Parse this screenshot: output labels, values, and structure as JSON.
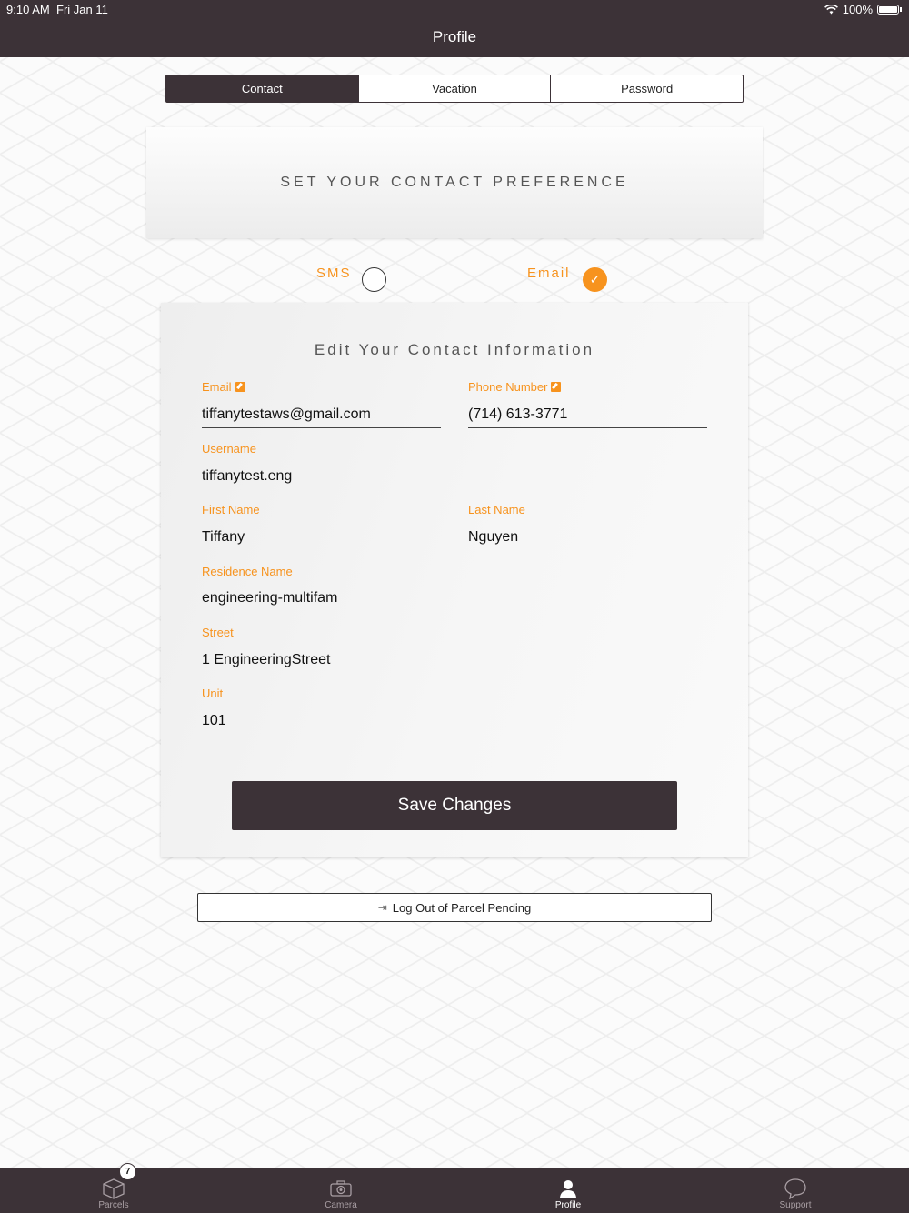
{
  "status_bar": {
    "time": "9:10 AM",
    "date": "Fri Jan 11",
    "battery": "100%"
  },
  "header": {
    "title": "Profile"
  },
  "tabs": [
    {
      "label": "Contact",
      "active": true
    },
    {
      "label": "Vacation",
      "active": false
    },
    {
      "label": "Password",
      "active": false
    }
  ],
  "preference": {
    "title": "SET YOUR CONTACT PREFERENCE",
    "sms_label": "SMS",
    "sms_selected": false,
    "email_label": "Email",
    "email_selected": true
  },
  "contact": {
    "title": "Edit Your Contact Information",
    "email_label": "Email",
    "email_value": "tiffanytestaws@gmail.com",
    "phone_label": "Phone Number",
    "phone_value": "(714) 613-3771",
    "username_label": "Username",
    "username_value": "tiffanytest.eng",
    "first_name_label": "First Name",
    "first_name_value": "Tiffany",
    "last_name_label": "Last Name",
    "last_name_value": "Nguyen",
    "residence_label": "Residence Name",
    "residence_value": "engineering-multifam",
    "street_label": "Street",
    "street_value": "1 EngineeringStreet",
    "unit_label": "Unit",
    "unit_value": "101",
    "save_label": "Save Changes"
  },
  "logout_label": "Log Out of Parcel Pending",
  "bottom_tabs": [
    {
      "label": "Parcels",
      "icon": "box-icon",
      "badge": "7"
    },
    {
      "label": "Camera",
      "icon": "camera-icon"
    },
    {
      "label": "Profile",
      "icon": "person-icon",
      "active": true
    },
    {
      "label": "Support",
      "icon": "chat-bubble-icon"
    }
  ],
  "colors": {
    "brand_dark": "#3c3237",
    "accent": "#f7931e"
  }
}
